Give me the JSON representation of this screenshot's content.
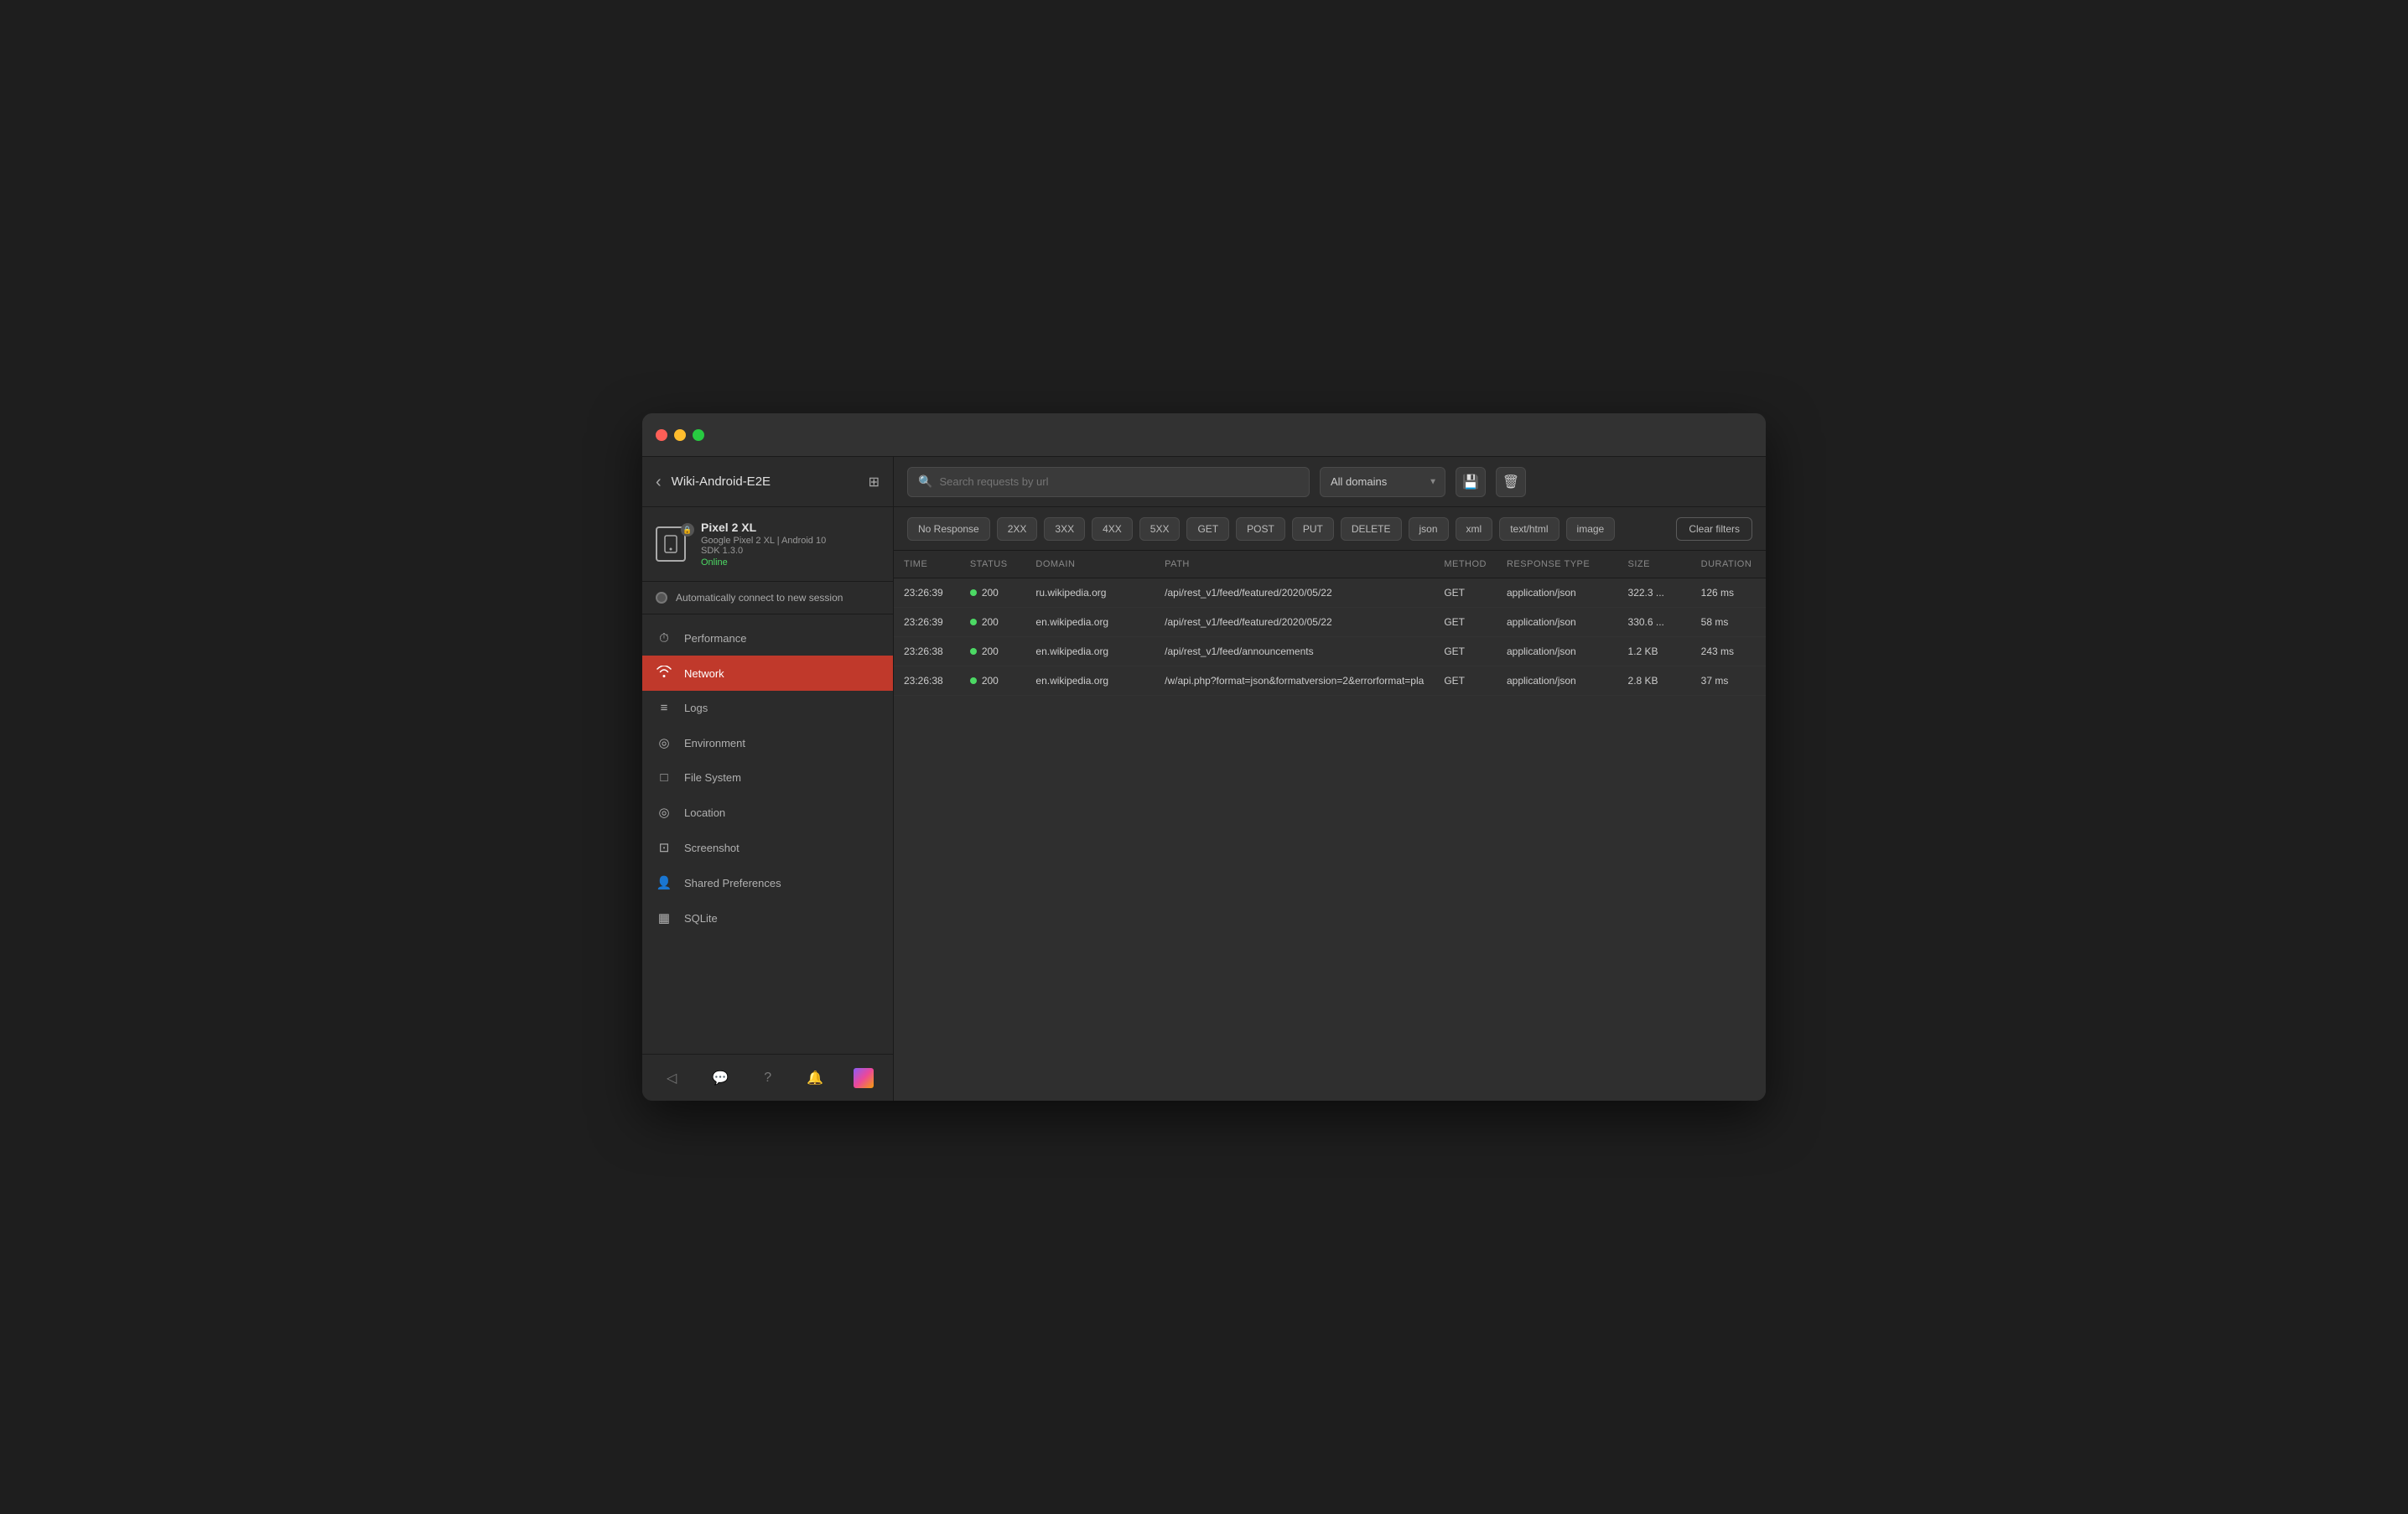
{
  "window": {
    "title": "Wiki-Android-E2E"
  },
  "device": {
    "name": "Pixel 2 XL",
    "model": "Google Pixel 2 XL | Android 10",
    "sdk": "SDK 1.3.0",
    "status": "Online"
  },
  "auto_connect": {
    "label": "Automatically connect to new session"
  },
  "nav": {
    "items": [
      {
        "id": "performance",
        "label": "Performance",
        "icon": "⏱"
      },
      {
        "id": "network",
        "label": "Network",
        "icon": "📶"
      },
      {
        "id": "logs",
        "label": "Logs",
        "icon": "☰"
      },
      {
        "id": "environment",
        "label": "Environment",
        "icon": "◎"
      },
      {
        "id": "filesystem",
        "label": "File System",
        "icon": "□"
      },
      {
        "id": "location",
        "label": "Location",
        "icon": "◎"
      },
      {
        "id": "screenshot",
        "label": "Screenshot",
        "icon": "⊡"
      },
      {
        "id": "shared-prefs",
        "label": "Shared Preferences",
        "icon": "👤"
      },
      {
        "id": "sqlite",
        "label": "SQLite",
        "icon": "▦"
      }
    ]
  },
  "toolbar": {
    "search_placeholder": "Search requests by url",
    "domain_label": "All domains",
    "save_label": "💾",
    "delete_label": "🗑"
  },
  "filters": {
    "chips": [
      "No Response",
      "2XX",
      "3XX",
      "4XX",
      "5XX",
      "GET",
      "POST",
      "PUT",
      "DELETE",
      "json",
      "xml",
      "text/html",
      "image"
    ],
    "clear_label": "Clear filters"
  },
  "table": {
    "columns": [
      "TIME",
      "STATUS",
      "DOMAIN",
      "PATH",
      "METHOD",
      "RESPONSE TYPE",
      "SIZE",
      "DURATION"
    ],
    "rows": [
      {
        "time": "23:26:39",
        "status": "200",
        "status_ok": true,
        "domain": "ru.wikipedia.org",
        "path": "/api/rest_v1/feed/featured/2020/05/22",
        "method": "GET",
        "response_type": "application/json",
        "size": "322.3 ...",
        "duration": "126 ms"
      },
      {
        "time": "23:26:39",
        "status": "200",
        "status_ok": true,
        "domain": "en.wikipedia.org",
        "path": "/api/rest_v1/feed/featured/2020/05/22",
        "method": "GET",
        "response_type": "application/json",
        "size": "330.6 ...",
        "duration": "58 ms"
      },
      {
        "time": "23:26:38",
        "status": "200",
        "status_ok": true,
        "domain": "en.wikipedia.org",
        "path": "/api/rest_v1/feed/announcements",
        "method": "GET",
        "response_type": "application/json",
        "size": "1.2 KB",
        "duration": "243 ms"
      },
      {
        "time": "23:26:38",
        "status": "200",
        "status_ok": true,
        "domain": "en.wikipedia.org",
        "path": "/w/api.php?format=json&formatversion=2&errorformat=pla",
        "method": "GET",
        "response_type": "application/json",
        "size": "2.8 KB",
        "duration": "37 ms"
      }
    ]
  },
  "colors": {
    "active_nav": "#c0392b",
    "status_ok": "#4cd964",
    "online": "#4cd964"
  }
}
